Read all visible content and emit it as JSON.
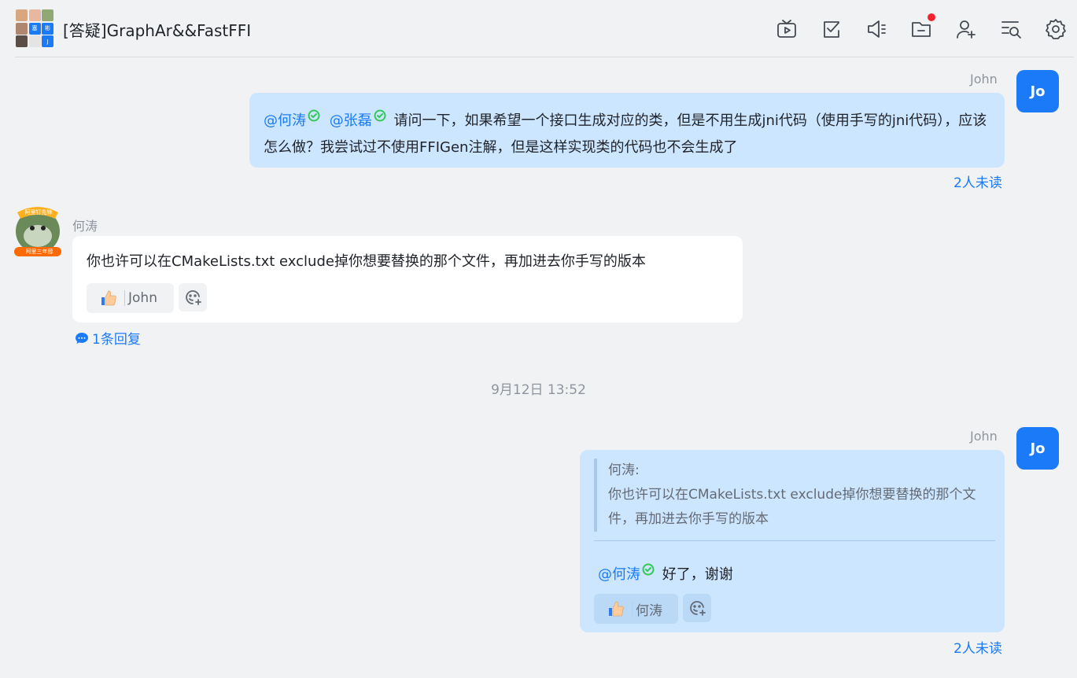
{
  "header": {
    "title": "[答疑]GraphAr&&FastFFI",
    "group_avatar_cells": [
      "",
      "",
      "",
      "",
      "塞",
      "彬",
      "",
      "",
      "J"
    ],
    "icons": [
      "tv-icon",
      "task-check-icon",
      "announcement-icon",
      "folder-icon",
      "add-member-icon",
      "search-history-icon",
      "settings-icon"
    ]
  },
  "messages": [
    {
      "sender": "John",
      "avatar_text": "Jo",
      "mentions": [
        "@何涛",
        "@张磊"
      ],
      "text": "请问一下，如果希望一个接口生成对应的类，但是不用生成jni代码（使用手写的jni代码），应该怎么做？我尝试过不使用FFIGen注解，但是这样实现类的代码也不会生成了",
      "status": "2人未读"
    },
    {
      "sender": "何涛",
      "avatar_badge": "阿里钉先锋",
      "avatar_tag": "阿里三年醇",
      "text": "你也许可以在CMakeLists.txt exclude掉你想要替换的那个文件，再加进去你手写的版本",
      "reaction": {
        "emoji": "thumbs-up",
        "user": "John"
      },
      "reply_link": "1条回复"
    },
    {
      "timestamp": "9月12日 13:52"
    },
    {
      "sender": "John",
      "avatar_text": "Jo",
      "quote": {
        "author": "何涛:",
        "text": "你也许可以在CMakeLists.txt exclude掉你想要替换的那个文件，再加进去你手写的版本"
      },
      "mention": "@何涛",
      "text": "好了，谢谢",
      "reaction": {
        "emoji": "thumbs-up",
        "user": "何涛"
      },
      "status": "2人未读"
    }
  ],
  "colors": {
    "accent": "#1a7af8",
    "outgoing_bubble": "#cce6ff",
    "incoming_bubble": "#ffffff",
    "background": "#f1f2f4",
    "verified": "#34c759"
  }
}
